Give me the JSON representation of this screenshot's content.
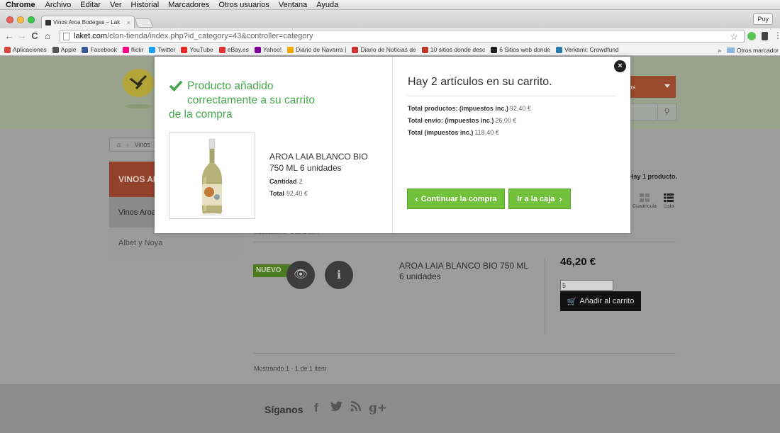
{
  "menubar": {
    "app": "Chrome",
    "items": [
      "Archivo",
      "Editar",
      "Ver",
      "Historial",
      "Marcadores",
      "Otros usuarios",
      "Ventana",
      "Ayuda"
    ]
  },
  "browser": {
    "tab_title": "Vinos Aroa Bodegas – Lak",
    "tab_close": "×",
    "profile": "Puy",
    "url_host": "laket.com",
    "url_path": "/clon-tienda/index.php?id_category=43&controller=category",
    "nav_back": "←",
    "nav_forward": "→",
    "nav_reload": "C",
    "nav_home": "⌂",
    "bookmark_star": "☆"
  },
  "bookmarks": {
    "items": [
      {
        "label": "Aplicaciones",
        "color": "#d44638"
      },
      {
        "label": "Apple",
        "color": "#555555"
      },
      {
        "label": "Facebook",
        "color": "#3b5998"
      },
      {
        "label": "flickr",
        "color": "#ff0084"
      },
      {
        "label": "Twitter",
        "color": "#1da1f2"
      },
      {
        "label": "YouTube",
        "color": "#e52d27"
      },
      {
        "label": "eBay.es",
        "color": "#e53238"
      },
      {
        "label": "Yahoo!",
        "color": "#7b0099"
      },
      {
        "label": "Diario de Navarra | ",
        "color": "#f0a800"
      },
      {
        "label": "Diario de Noticias de",
        "color": "#cc3333"
      },
      {
        "label": "10 sitios donde desc",
        "color": "#c0392b"
      },
      {
        "label": "6 Sitios web donde",
        "color": "#222222"
      },
      {
        "label": "Verkami: Crowdfund",
        "color": "#2a7ab0"
      }
    ],
    "overflow": "»",
    "other": "Otros marcador"
  },
  "page": {
    "cart_button": "tos",
    "breadcrumb": "Vinos",
    "sidebar_title": "VINOS AI",
    "sidebar_items": [
      "Vinos Aroa",
      "Albet y Noya"
    ],
    "product_count": "Hay 1 producto.",
    "view_grid": "Cuadrícula",
    "view_list": "Lista",
    "showing_top": "Mostrando 1 - 1 de 1 item",
    "badge_new": "NUEVO",
    "product_name": "AROA LAIA BLANCO BIO 750 ML 6 unidades",
    "price": "46,20 €",
    "qty_value": "5",
    "add_to_cart": "Añadir al carrito",
    "showing_bottom": "Mostrando 1 - 1 de 1 item",
    "follow": "Síganos",
    "social": {
      "facebook": "f",
      "twitter": "t",
      "rss": "rss",
      "gplus": "g+"
    }
  },
  "modal": {
    "success_line1": "Producto añadido",
    "success_line2": "correctamente a su carrito",
    "success_line3": "de la compra",
    "product_name_line1": "AROA LAIA BLANCO BIO",
    "product_name_line2": "750 ML 6 unidades",
    "qty_label": "Cantidad",
    "qty_value": "2",
    "total_label": "Total",
    "total_value": "92,40 €",
    "cart_title": "Hay 2 artículos en su carrito.",
    "totals": [
      {
        "label": "Total productos: (impuestos inc.)",
        "value": "92,40 €"
      },
      {
        "label": "Total envío: (impuestos inc.)",
        "value": "26,00 €"
      },
      {
        "label": "Total (impuestos inc.)",
        "value": "118,40 €"
      }
    ],
    "continue_label": "Continuar la compra",
    "checkout_label": "Ir a la caja",
    "close": "×"
  },
  "colors": {
    "green_text": "#46a74e",
    "green_button": "#71c13a",
    "brand_red_dimmed": "#92412a",
    "new_badge_dimmed": "#4b7a21"
  }
}
